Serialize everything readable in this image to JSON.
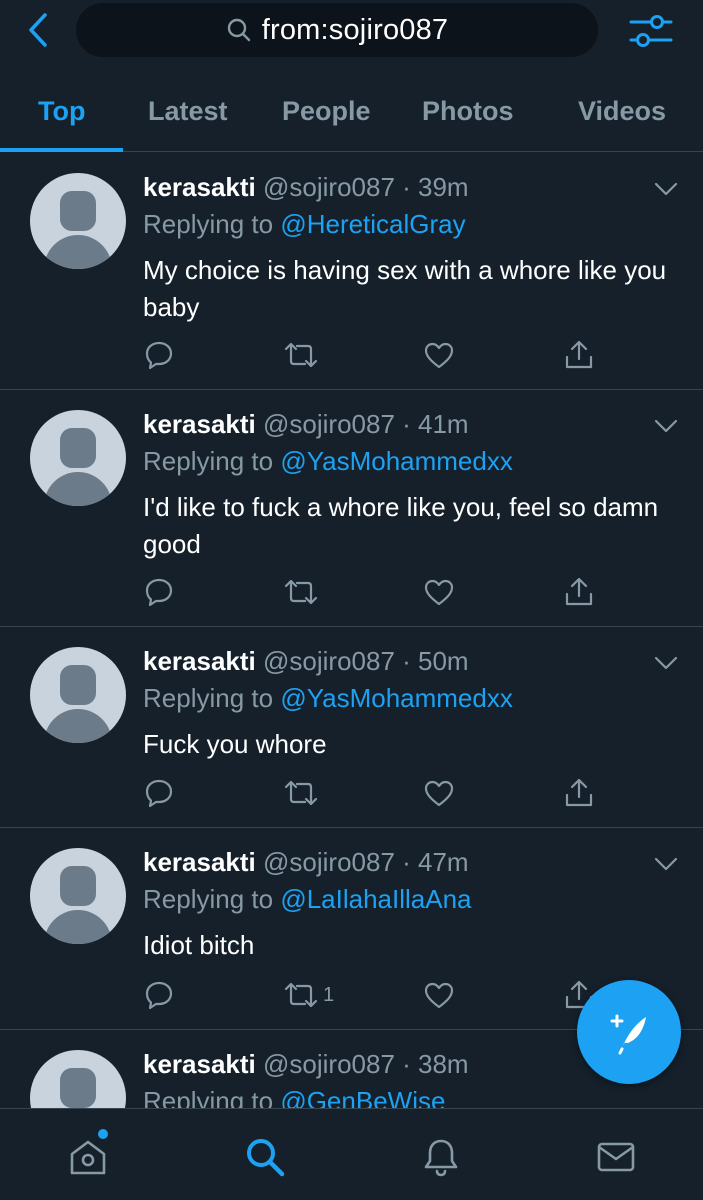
{
  "search": {
    "query": "from:sojiro087"
  },
  "tabs": [
    {
      "label": "Top",
      "active": true
    },
    {
      "label": "Latest",
      "active": false
    },
    {
      "label": "People",
      "active": false
    },
    {
      "label": "Photos",
      "active": false
    },
    {
      "label": "Videos",
      "active": false
    }
  ],
  "tweets": [
    {
      "name": "kerasakti",
      "handle": "@sojiro087",
      "time": "39m",
      "replying_prefix": "Replying to ",
      "replying_to": "@HereticalGray",
      "text": "My choice is having sex with a whore like you baby",
      "retweets": ""
    },
    {
      "name": "kerasakti",
      "handle": "@sojiro087",
      "time": "41m",
      "replying_prefix": "Replying to ",
      "replying_to": "@YasMohammedxx",
      "text": "I'd like to fuck a whore like you, feel so damn good",
      "retweets": ""
    },
    {
      "name": "kerasakti",
      "handle": "@sojiro087",
      "time": "50m",
      "replying_prefix": "Replying to ",
      "replying_to": "@YasMohammedxx",
      "text": "Fuck you whore",
      "retweets": ""
    },
    {
      "name": "kerasakti",
      "handle": "@sojiro087",
      "time": "47m",
      "replying_prefix": "Replying to ",
      "replying_to": "@LaIlahaIllaAna",
      "text": "Idiot bitch",
      "retweets": "1"
    },
    {
      "name": "kerasakti",
      "handle": "@sojiro087",
      "time": "38m",
      "replying_prefix": "Replying to ",
      "replying_to": "@GenBeWise",
      "text": "",
      "retweets": ""
    }
  ],
  "icons": {
    "back": "chevron-left-icon",
    "search": "search-icon",
    "filter": "sliders-icon",
    "reply": "reply-icon",
    "retweet": "retweet-icon",
    "like": "heart-icon",
    "share": "share-icon",
    "compose": "compose-tweet-icon",
    "home": "home-icon",
    "explore": "search-icon",
    "notifications": "bell-icon",
    "messages": "mail-icon"
  },
  "colors": {
    "background": "#15202b",
    "accent": "#1da1f2",
    "muted": "#8899a6",
    "divider": "#38444d"
  }
}
